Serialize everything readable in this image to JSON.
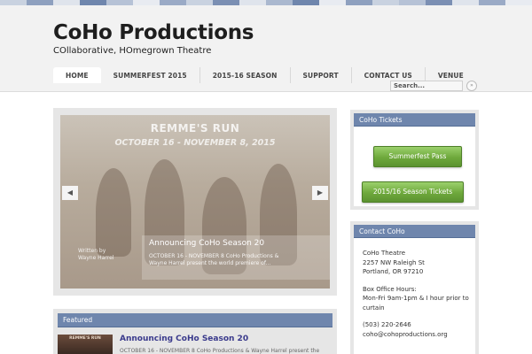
{
  "header": {
    "site_title": "CoHo Productions",
    "tagline": "COllaborative, HOmegrown Theatre"
  },
  "nav": {
    "items": [
      {
        "label": "HOME",
        "active": true
      },
      {
        "label": "SUMMERFEST 2015",
        "active": false
      },
      {
        "label": "2015-16 SEASON",
        "active": false
      },
      {
        "label": "SUPPORT",
        "active": false
      },
      {
        "label": "CONTACT US",
        "active": false
      },
      {
        "label": "VENUE",
        "active": false
      }
    ]
  },
  "search": {
    "value": "Search...",
    "button_icon": "arrow-right-icon"
  },
  "slider": {
    "title": "REMME'S RUN",
    "dates": "OCTOBER 16 - NOVEMBER 8, 2015",
    "credit_line1": "Written by",
    "credit_line2": "Wayne Harrel",
    "caption_title": "Announcing CoHo Season 20",
    "caption_text_1": "OCTOBER 16 - NOVEMBER 8 CoHo Productions &",
    "caption_text_2": "Wayne Harrel present the world premiere of...",
    "prev_icon": "chevron-left-icon",
    "next_icon": "chevron-right-icon"
  },
  "featured": {
    "heading": "Featured",
    "item_title": "Announcing CoHo Season 20",
    "item_excerpt": "OCTOBER 16 - NOVEMBER 8 CoHo Productions & Wayne Harrel present the",
    "thumb_text": "REMME'S RUN"
  },
  "sidebar": {
    "tickets_heading": "CoHo Tickets",
    "summerfest_button": "Summerfest Pass",
    "season_button": "2015/16 Season Tickets",
    "contact_heading": "Contact CoHo",
    "contact_name": "CoHo Theatre",
    "contact_street": "2257 NW Raleigh St",
    "contact_city": "Portland, OR 97210",
    "hours_label": "Box Office Hours:",
    "hours_line1": "Mon-Fri 9am-1pm & I hour prior to",
    "hours_line2": "curtain",
    "phone": "(503) 220-2646",
    "email": "coho@cohoproductions.org"
  },
  "colors": {
    "accent_blue": "#6f86ad",
    "button_green": "#6ea83c",
    "title_link": "#3a3a8c"
  }
}
